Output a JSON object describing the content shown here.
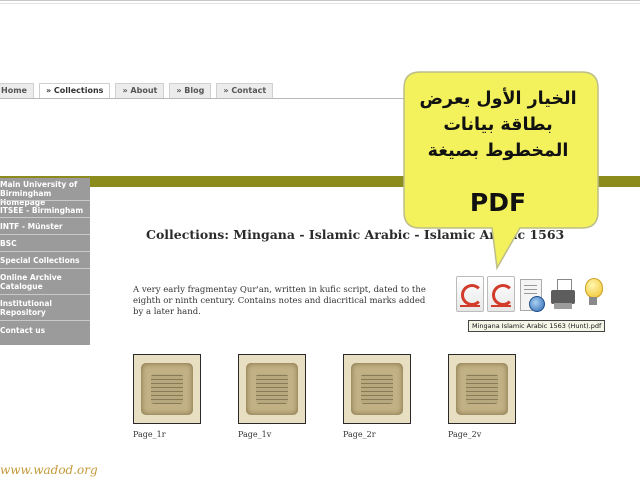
{
  "nav": {
    "tabs": [
      {
        "label": "Home",
        "active": false
      },
      {
        "label": "» Collections",
        "active": true
      },
      {
        "label": "» About",
        "active": false
      },
      {
        "label": "» Blog",
        "active": false
      },
      {
        "label": "» Contact",
        "active": false
      }
    ]
  },
  "sidebar": {
    "items": [
      {
        "label": "Main University of Birmingham Homepage"
      },
      {
        "label": "ITSEE - Birmingham"
      },
      {
        "label": "INTF - Münster"
      },
      {
        "label": "BSC"
      },
      {
        "label": "Special Collections"
      },
      {
        "label": "Online Archive Catalogue"
      },
      {
        "label": "Institutional Repository"
      },
      {
        "label": "Contact us"
      }
    ]
  },
  "main": {
    "heading": "Collections: Mingana - Islamic Arabic - Islamic Arabic 1563",
    "description": "A very early fragmentay Qur'an, written in kufic script, dated to the eighth or ninth century. Contains notes and diacritical marks added by a later hand.",
    "icons": [
      {
        "name": "ecard-pdf-icon"
      },
      {
        "name": "ecard-icon"
      },
      {
        "name": "web-document-icon"
      },
      {
        "name": "printer-icon"
      },
      {
        "name": "lightbulb-icon"
      }
    ],
    "tooltip": "Mingana Islamic Arabic 1563 (Hunt).pdf",
    "pages": [
      {
        "label": "Page_1r"
      },
      {
        "label": "Page_1v"
      },
      {
        "label": "Page_2r"
      },
      {
        "label": "Page_2v"
      }
    ]
  },
  "annotation": {
    "line1": "الخيار الأول يعرض",
    "line2": "بطاقة بيانات",
    "line3": "المخطوط بصيغة",
    "line4": "PDF",
    "fill_color": "#f3f25c"
  },
  "watermark": "www.wadod.org",
  "colors": {
    "band": "#8c8c1c",
    "sidebar": "#9b9b9b",
    "bubble_fill": "#f3f25c"
  }
}
